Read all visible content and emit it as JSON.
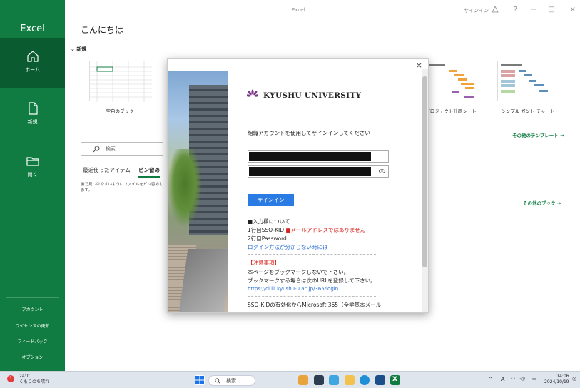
{
  "window": {
    "title": "Excel",
    "signin": "サインイン",
    "help": "?",
    "minimize": "−",
    "restore": "□",
    "close": "×"
  },
  "sidebar": {
    "app_name": "Excel",
    "items": [
      {
        "label": "ホーム",
        "icon": "home-icon"
      },
      {
        "label": "新規",
        "icon": "new-file-icon"
      },
      {
        "label": "開く",
        "icon": "folder-icon"
      }
    ],
    "bottom": [
      "アカウント",
      "ライセンスの更新",
      "フィードバック",
      "オプション"
    ]
  },
  "main": {
    "greeting": "こんにちは",
    "new_section": "新規",
    "templates": [
      {
        "label": "空白のブック"
      },
      {
        "label": "プロジェクト計画シート"
      },
      {
        "label": "シンプル ガント チャート"
      }
    ],
    "more_templates": "その他のテンプレート →",
    "search_placeholder": "検索",
    "tabs": {
      "recent": "最近使ったアイテム",
      "pinned": "ピン留め"
    },
    "pinned_hint": "後で見つけやすいようにファイルをピン留めします。",
    "more_books": "その他のブック →"
  },
  "modal": {
    "close": "×",
    "university": "KYUSHU UNIVERSITY",
    "prompt": "組織アカウントを使用してサインインしてください",
    "signin_button": "サインイン",
    "info_heading": "■入力欄について",
    "line1_prefix": "1行目SSO-KID",
    "line1_warning": "■メールアドレスではありません",
    "line2": "2行目Password",
    "help_link": "ログイン方法が分からない時には",
    "notice_heading": "【注意事項】",
    "notice1": "本ページをブックマークしないで下さい。",
    "notice2": "ブックマークする場合は次のURLを登録して下さい。",
    "url": "https://ci.iii.kyushu-u.ac.jp/365/login",
    "footer": "SSO-KIDの有効化からMicrosoft 365（全学基本メール"
  },
  "taskbar": {
    "notification_count": "1",
    "temperature": "24°C",
    "weather": "くもりのち晴れ",
    "search": "検索",
    "time": "14:06",
    "date": "2024/10/19",
    "ime": "A"
  },
  "colors": {
    "excel_green": "#107c41",
    "signin_blue": "#2a7be4",
    "warning_red": "#d9221b"
  }
}
